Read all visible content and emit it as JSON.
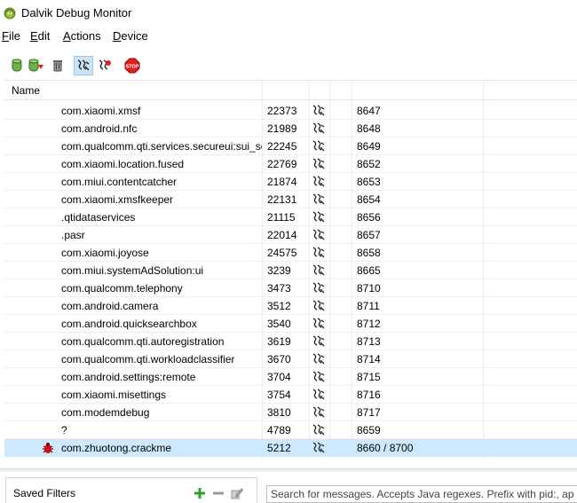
{
  "window": {
    "title": "Dalvik Debug Monitor"
  },
  "menu": [
    {
      "key": "F",
      "rest": "ile"
    },
    {
      "key": "E",
      "rest": "dit"
    },
    {
      "key": "A",
      "rest": "ctions"
    },
    {
      "key": "D",
      "rest": "evice"
    }
  ],
  "toolbar": {
    "icons": [
      "update-heap-icon",
      "dump-hprof-icon",
      "cause-gc-icon",
      "update-threads-icon",
      "start-method-profiling-icon",
      "stop-process-icon"
    ],
    "stop_label": "STOP",
    "colors": {
      "active_bg": "#cce4f7",
      "stop_red": "#e02020",
      "bug_red": "#d01010"
    }
  },
  "table": {
    "header": {
      "name": "Name"
    },
    "rows": [
      {
        "name": "com.xiaomi.xmsf",
        "pid": "22373",
        "port": "8647"
      },
      {
        "name": "com.android.nfc",
        "pid": "21989",
        "port": "8648"
      },
      {
        "name": "com.qualcomm.qti.services.secureui:sui_service",
        "pid": "22245",
        "port": "8649"
      },
      {
        "name": "com.xiaomi.location.fused",
        "pid": "22769",
        "port": "8652"
      },
      {
        "name": "com.miui.contentcatcher",
        "pid": "21874",
        "port": "8653"
      },
      {
        "name": "com.xiaomi.xmsfkeeper",
        "pid": "22131",
        "port": "8654"
      },
      {
        "name": ".qtidataservices",
        "pid": "21115",
        "port": "8656"
      },
      {
        "name": ".pasr",
        "pid": "22014",
        "port": "8657"
      },
      {
        "name": "com.xiaomi.joyose",
        "pid": "24575",
        "port": "8658"
      },
      {
        "name": "com.miui.systemAdSolution:ui",
        "pid": "3239",
        "port": "8665"
      },
      {
        "name": "com.qualcomm.telephony",
        "pid": "3473",
        "port": "8710"
      },
      {
        "name": "com.android.camera",
        "pid": "3512",
        "port": "8711"
      },
      {
        "name": "com.android.quicksearchbox",
        "pid": "3540",
        "port": "8712"
      },
      {
        "name": "com.qualcomm.qti.autoregistration",
        "pid": "3619",
        "port": "8713"
      },
      {
        "name": "com.qualcomm.qti.workloadclassifier",
        "pid": "3670",
        "port": "8714"
      },
      {
        "name": "com.android.settings:remote",
        "pid": "3704",
        "port": "8715"
      },
      {
        "name": "com.xiaomi.misettings",
        "pid": "3754",
        "port": "8716"
      },
      {
        "name": "com.modemdebug",
        "pid": "3810",
        "port": "8717"
      },
      {
        "name": "?",
        "pid": "4789",
        "port": "8659"
      },
      {
        "name": "com.zhuotong.crackme",
        "pid": "5212",
        "port": "8660 / 8700",
        "selected": true,
        "debug": true
      }
    ]
  },
  "saved_filters": {
    "label": "Saved Filters"
  },
  "logcat": {
    "search_placeholder": "Search for messages. Accepts Java regexes. Prefix with pid:, app:, tag: or text: to limit scope."
  }
}
